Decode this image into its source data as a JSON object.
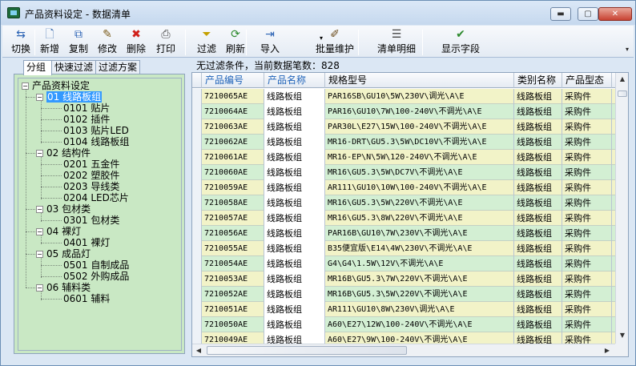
{
  "window": {
    "title": "产品资料设定 - 数据清单",
    "min_label": "▬",
    "max_label": "▢",
    "close_label": "✕"
  },
  "toolbar": {
    "items": [
      {
        "label": "切换",
        "icon": "switch-icon",
        "glyph": "⇆",
        "color": "#2a62b4"
      },
      {
        "label": "新增",
        "icon": "new-document-icon",
        "glyph": "🗋",
        "color": "#3f6fb0"
      },
      {
        "label": "复制",
        "icon": "copy-icon",
        "glyph": "⧉",
        "color": "#2a62b4"
      },
      {
        "label": "修改",
        "icon": "edit-icon",
        "glyph": "✎",
        "color": "#7a5a1a"
      },
      {
        "label": "删除",
        "icon": "delete-icon",
        "glyph": "✖",
        "color": "#d0201a"
      },
      {
        "label": "打印",
        "icon": "print-icon",
        "glyph": "⎙",
        "color": "#444444"
      },
      {
        "label": "过滤",
        "icon": "filter-icon",
        "glyph": "⏷",
        "color": "#c4a000"
      },
      {
        "label": "刷新",
        "icon": "refresh-icon",
        "glyph": "⟳",
        "color": "#2d8a2d"
      },
      {
        "label": "导入",
        "icon": "import-icon",
        "glyph": "⇥",
        "color": "#2a62b4"
      },
      {
        "label": "批量维护",
        "icon": "batch-edit-icon",
        "glyph": "✐",
        "color": "#6a4a1a"
      },
      {
        "label": "清单明细",
        "icon": "list-detail-icon",
        "glyph": "☰",
        "color": "#444444"
      },
      {
        "label": "显示字段",
        "icon": "show-fields-icon",
        "glyph": "✔",
        "color": "#2d8a2d"
      }
    ],
    "import_dropdown": "▾",
    "more": "▾"
  },
  "tabs": [
    "分组",
    "快速过滤",
    "过滤方案"
  ],
  "tree": {
    "root": "产品资料设定",
    "groups": [
      {
        "label": "01 线路板组",
        "children": [
          "0101 贴片",
          "0102 插件",
          "0103 贴片LED",
          "0104 线路板组"
        ]
      },
      {
        "label": "02 结构件",
        "children": [
          "0201 五金件",
          "0202 塑胶件",
          "0203 导线类",
          "0204 LED芯片"
        ]
      },
      {
        "label": "03 包材类",
        "children": [
          "0301 包材类"
        ]
      },
      {
        "label": "04 裸灯",
        "children": [
          "0401 裸灯"
        ]
      },
      {
        "label": "05 成品灯",
        "children": [
          "0501 自制成品",
          "0502 外购成品"
        ]
      },
      {
        "label": "06 辅料类",
        "children": [
          "0601 辅料"
        ]
      }
    ],
    "selected": "01 线路板组"
  },
  "status": "无过滤条件，当前数据笔数：828",
  "grid": {
    "columns": [
      "产品编号",
      "产品名称",
      "规格型号",
      "类别名称",
      "产品型态"
    ],
    "rows": [
      [
        "7210065AE",
        "线路板组",
        "PAR16SB\\GU10\\5W\\230V\\调光\\A\\E",
        "线路板组",
        "采购件"
      ],
      [
        "7210064AE",
        "线路板组",
        "PAR16\\GU10\\7W\\100-240V\\不调光\\A\\E",
        "线路板组",
        "采购件"
      ],
      [
        "7210063AE",
        "线路板组",
        "PAR30L\\E27\\15W\\100-240V\\不调光\\A\\E",
        "线路板组",
        "采购件"
      ],
      [
        "7210062AE",
        "线路板组",
        "MR16-DRT\\GU5.3\\5W\\DC10V\\不调光\\A\\E",
        "线路板组",
        "采购件"
      ],
      [
        "7210061AE",
        "线路板组",
        "MR16-EP\\N\\5W\\120-240V\\不调光\\A\\E",
        "线路板组",
        "采购件"
      ],
      [
        "7210060AE",
        "线路板组",
        "MR16\\GU5.3\\5W\\DC7V\\不调光\\A\\E",
        "线路板组",
        "采购件"
      ],
      [
        "7210059AE",
        "线路板组",
        "AR111\\GU10\\10W\\100-240V\\不调光\\A\\E",
        "线路板组",
        "采购件"
      ],
      [
        "7210058AE",
        "线路板组",
        "MR16\\GU5.3\\5W\\220V\\不调光\\A\\E",
        "线路板组",
        "采购件"
      ],
      [
        "7210057AE",
        "线路板组",
        "MR16\\GU5.3\\8W\\220V\\不调光\\A\\E",
        "线路板组",
        "采购件"
      ],
      [
        "7210056AE",
        "线路板组",
        "PAR16B\\GU10\\7W\\230V\\不调光\\A\\E",
        "线路板组",
        "采购件"
      ],
      [
        "7210055AE",
        "线路板组",
        "B35便宜版\\E14\\4W\\230V\\不调光\\A\\E",
        "线路板组",
        "采购件"
      ],
      [
        "7210054AE",
        "线路板组",
        "G4\\G4\\1.5W\\12V\\不调光\\A\\E",
        "线路板组",
        "采购件"
      ],
      [
        "7210053AE",
        "线路板组",
        "MR16B\\GU5.3\\7W\\220V\\不调光\\A\\E",
        "线路板组",
        "采购件"
      ],
      [
        "7210052AE",
        "线路板组",
        "MR16B\\GU5.3\\5W\\220V\\不调光\\A\\E",
        "线路板组",
        "采购件"
      ],
      [
        "7210051AE",
        "线路板组",
        "AR111\\GU10\\8W\\230V\\调光\\A\\E",
        "线路板组",
        "采购件"
      ],
      [
        "7210050AE",
        "线路板组",
        "A60\\E27\\12W\\100-240V\\不调光\\A\\E",
        "线路板组",
        "采购件"
      ],
      [
        "7210049AE",
        "线路板组",
        "A60\\E27\\9W\\100-240V\\不调光\\A\\E",
        "线路板组",
        "采购件"
      ]
    ]
  },
  "scroll": {
    "up": "▲",
    "down": "▼",
    "left": "◀",
    "right": "▶"
  }
}
